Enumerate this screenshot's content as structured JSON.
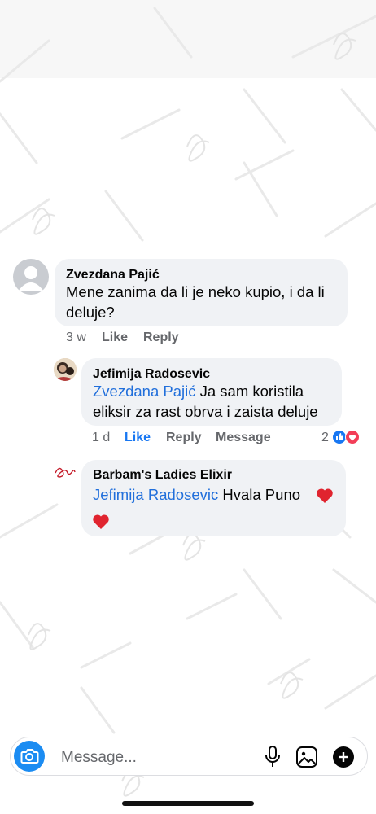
{
  "comments": [
    {
      "author": "Zvezdana Pajić",
      "text_line1": "Mene zanima da li je neko kupio, i da li",
      "text_line2": "deluje?",
      "time": "3 w",
      "like_label": "Like",
      "reply_label": "Reply"
    },
    {
      "author": "Jefimija Radosevic",
      "mention": "Zvezdana Pajić",
      "text_line1_rest": " Ja sam koristila",
      "text_line2": "eliksir za rast obrva i zaista deluje",
      "time": "1 d",
      "like_label": "Like",
      "reply_label": "Reply",
      "message_label": "Message",
      "reaction_count": "2",
      "like_active": true
    },
    {
      "author": "Barbam's Ladies Elixir",
      "mention": "Jefimija Radosevic",
      "text_rest": " Hvala Puno",
      "emoji": "❤️"
    }
  ],
  "composer": {
    "placeholder": "Message...",
    "icons": [
      "camera-icon",
      "microphone-icon",
      "gallery-icon",
      "plus-icon"
    ]
  },
  "colors": {
    "accent": "#1877f2",
    "mention": "#216fdb",
    "bubble": "#f0f2f5",
    "meta": "#65676b",
    "heart": "#e0242f"
  }
}
